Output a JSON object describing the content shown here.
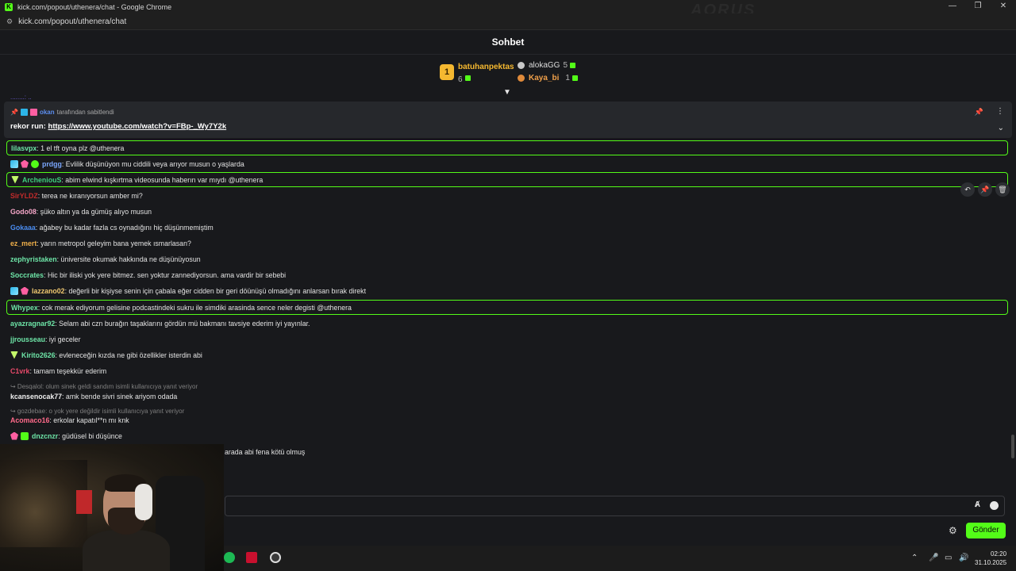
{
  "window": {
    "title": "kick.com/popout/uthenera/chat - Google Chrome",
    "url": "kick.com/popout/uthenera/chat",
    "favicon": "K",
    "watermark": "AORUS"
  },
  "chat": {
    "title": "Sohbet"
  },
  "leaderboard": {
    "first": {
      "rank": "1",
      "name": "batuhanpektas",
      "count": "6"
    },
    "second": {
      "name": "alokaGG",
      "count": "5"
    },
    "third": {
      "name": "Kaya_bi",
      "count": "1"
    }
  },
  "pinned": {
    "pinned_by": "okan",
    "pinned_label": "tarafından sabitlendi",
    "prefix": "rekor run:",
    "link": "https://www.youtube.com/watch?v=FBp-_Wy7Y2k"
  },
  "top_partial": "........: ..",
  "messages": [
    {
      "user": "lilasvpx",
      "color": "#6ee6a8",
      "text": ": 1 el tft oyna plz @uthenera",
      "hl": true,
      "badges": []
    },
    {
      "user": "prdgg",
      "color": "#7ba7ff",
      "text": ": Evlilik düşünüyon mu ciddili veya arıyor musun o yaşlarda",
      "hl": false,
      "badges": [
        "b-og",
        "b-sub",
        "b-ver"
      ]
    },
    {
      "user": "ArcheniouS",
      "color": "#3fd07f",
      "text": ": abim elwind kışkırtma videosunda haberın var mıydı @uthenera",
      "hl": true,
      "badges": [
        "b-vip"
      ]
    },
    {
      "user": "SirYLDZ",
      "color": "#c42b2b",
      "text": ": terea ne kıranıyorsun amber mi?",
      "hl": false,
      "badges": []
    },
    {
      "user": "Godo08",
      "color": "#f5a6c8",
      "text": ": şüko altın ya da gümüş alıyo musun",
      "hl": false,
      "badges": []
    },
    {
      "user": "Gokaaa",
      "color": "#4a8cf0",
      "text": ": ağabey bu kadar fazla cs oynadığını hiç düşünmemiştim",
      "hl": false,
      "badges": []
    },
    {
      "user": "ez_mert",
      "color": "#f0b04a",
      "text": ": yarın metropol geleyim bana yemek ısmarlasan?",
      "hl": false,
      "badges": []
    },
    {
      "user": "zephyristaken",
      "color": "#6ee6a8",
      "text": ": üniversite okumak hakkında ne düşünüyosun",
      "hl": false,
      "badges": []
    },
    {
      "user": "Soccrates",
      "color": "#6ee6a8",
      "text": ": Hic bir iliski yok yere bitmez. sen yoktur zannediyorsun. ama vardir bir sebebi",
      "hl": false,
      "badges": []
    },
    {
      "user": "lazzano02",
      "color": "#f0c870",
      "text": ": değerli bir kişiyse senin için çabala eğer cidden bir geri döünüşü olmadığını anlarsan bırak direkt",
      "hl": false,
      "badges": [
        "b-og",
        "b-sub"
      ]
    },
    {
      "user": "Whypex",
      "color": "#6ee6a8",
      "text": ": cok merak ediyorum gelisine podcastindeki sukru ile simdiki arasinda sence neler degisti @uthenera",
      "hl": true,
      "badges": []
    },
    {
      "user": "ayazragnar92",
      "color": "#6ee6a8",
      "text": ": Selam abi czn burağın taşaklarını gördün mü bakmanı tavsiye ederim iyi yayınlar.",
      "hl": false,
      "badges": []
    },
    {
      "user": "jjrousseau",
      "color": "#6ee6a8",
      "text": ": iyi geceler",
      "hl": false,
      "badges": []
    },
    {
      "user": "Kirito2626",
      "color": "#6ee6a8",
      "text": ": evleneceğin kızda ne gibi özellikler isterdin abi",
      "hl": false,
      "badges": [
        "b-vip"
      ]
    },
    {
      "user": "C1vrk",
      "color": "#e84a6a",
      "text": ": tamam teşekkür ederim",
      "hl": false,
      "badges": []
    },
    {
      "user": "kcansenocak77",
      "color": "#f0f0f0",
      "text": ": amk bende sivri sinek ariyom odada",
      "hl": false,
      "badges": []
    },
    {
      "user": "Acomaco16",
      "color": "#ff6a8a",
      "text": ": erkolar kapatıl**n mı knk",
      "hl": false,
      "badges": []
    },
    {
      "user": "dnzcnzr",
      "color": "#6ee6a8",
      "text": ": güdüsel bi düşünce",
      "hl": false,
      "badges": [
        "b-sub",
        "b-gift"
      ]
    }
  ],
  "replies": [
    {
      "text": "↪ Desqalol: olum sinek geldi sandım isimli kullanıcıya yanıt veriyor"
    },
    {
      "text": "↪ gozdebae: o yok yere değildir isimli kullanıcıya yanıt veriyor"
    }
  ],
  "cut_message": "arada abi fena kötü olmuş",
  "input": {
    "placeholder": "",
    "value": ""
  },
  "send_label": "Gönder",
  "clock": {
    "time": "02:20",
    "date": "31.10.2025"
  },
  "icons": {
    "pin": "pin-icon",
    "more": "more-icon",
    "chevron": "chevron-down-icon",
    "undo": "undo-icon",
    "delete": "trash-icon",
    "settings": "gear-icon",
    "emote": "emote-icon",
    "translate": "translate-icon"
  },
  "colors": {
    "accent": "#53fc18",
    "background": "#18191c",
    "gold": "#f5b830"
  }
}
